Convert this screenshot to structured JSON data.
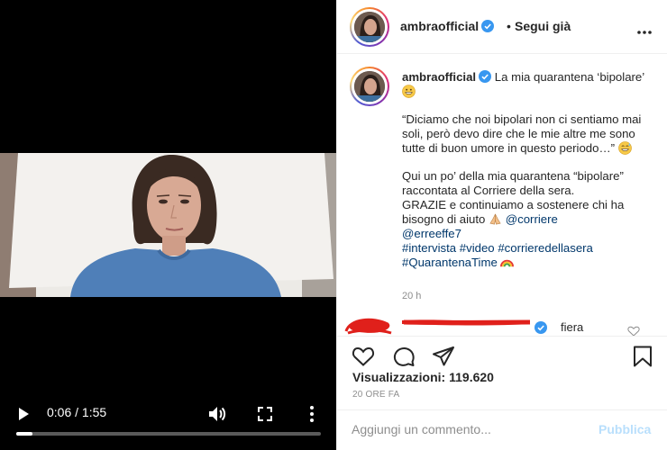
{
  "video": {
    "time": "0:06 / 1:55",
    "progress": 0.052,
    "icons": {
      "play": "play-icon",
      "volume": "volume-icon",
      "fullscreen": "fullscreen-icon",
      "more": "more-vertical-icon"
    }
  },
  "header": {
    "username": "ambraofficial",
    "separator": "•",
    "follow_label": "Segui già",
    "icons": {
      "verified": "verified-badge-icon",
      "more": "more-horizontal-icon"
    }
  },
  "caption": {
    "username": "ambraofficial",
    "line1": "La mia quarantena ‘bipolare’",
    "quote": "“Diciamo che noi bipolari non ci sentiamo mai soli, però devo dire che le mie altre me sono tutte di buon umore in questo periodo…”",
    "body1": "Qui un po’ della mia quarantena “bipolare” raccontata al Corriere della sera.",
    "body2": "GRAZIE e continuiamo a sostenere chi ha bisogno di aiuto",
    "mention1": "@corriere",
    "mention2": "@erreeffe7",
    "hashtags": [
      "#intervista",
      "#video",
      "#corrieredellasera",
      "#QuarantenaTime"
    ],
    "time": "20 h",
    "icons": {
      "grin": "grinning-emoji-icon",
      "sweat": "sweat-smile-emoji-icon",
      "pray": "folded-hands-emoji-icon",
      "rainbow": "rainbow-emoji-icon"
    }
  },
  "comment": {
    "text": "fiera",
    "icons": {
      "heart": "heart-outline-icon",
      "redaction": "red-scribble-redaction"
    }
  },
  "actions": {
    "views_label": "Visualizzazioni:",
    "views_count": "119.620",
    "date": "20 ORE FA",
    "icons": {
      "like": "heart-icon",
      "comment": "comment-icon",
      "share": "share-icon",
      "save": "bookmark-icon"
    }
  },
  "add_comment": {
    "placeholder": "Aggiungi un commento...",
    "publish_label": "Pubblica"
  },
  "colors": {
    "accent_link": "#00376b",
    "verified_blue": "#3897f0",
    "publish_disabled": "#b9dffc",
    "muted": "#8e8e8e",
    "redaction_red": "#e0201b"
  }
}
